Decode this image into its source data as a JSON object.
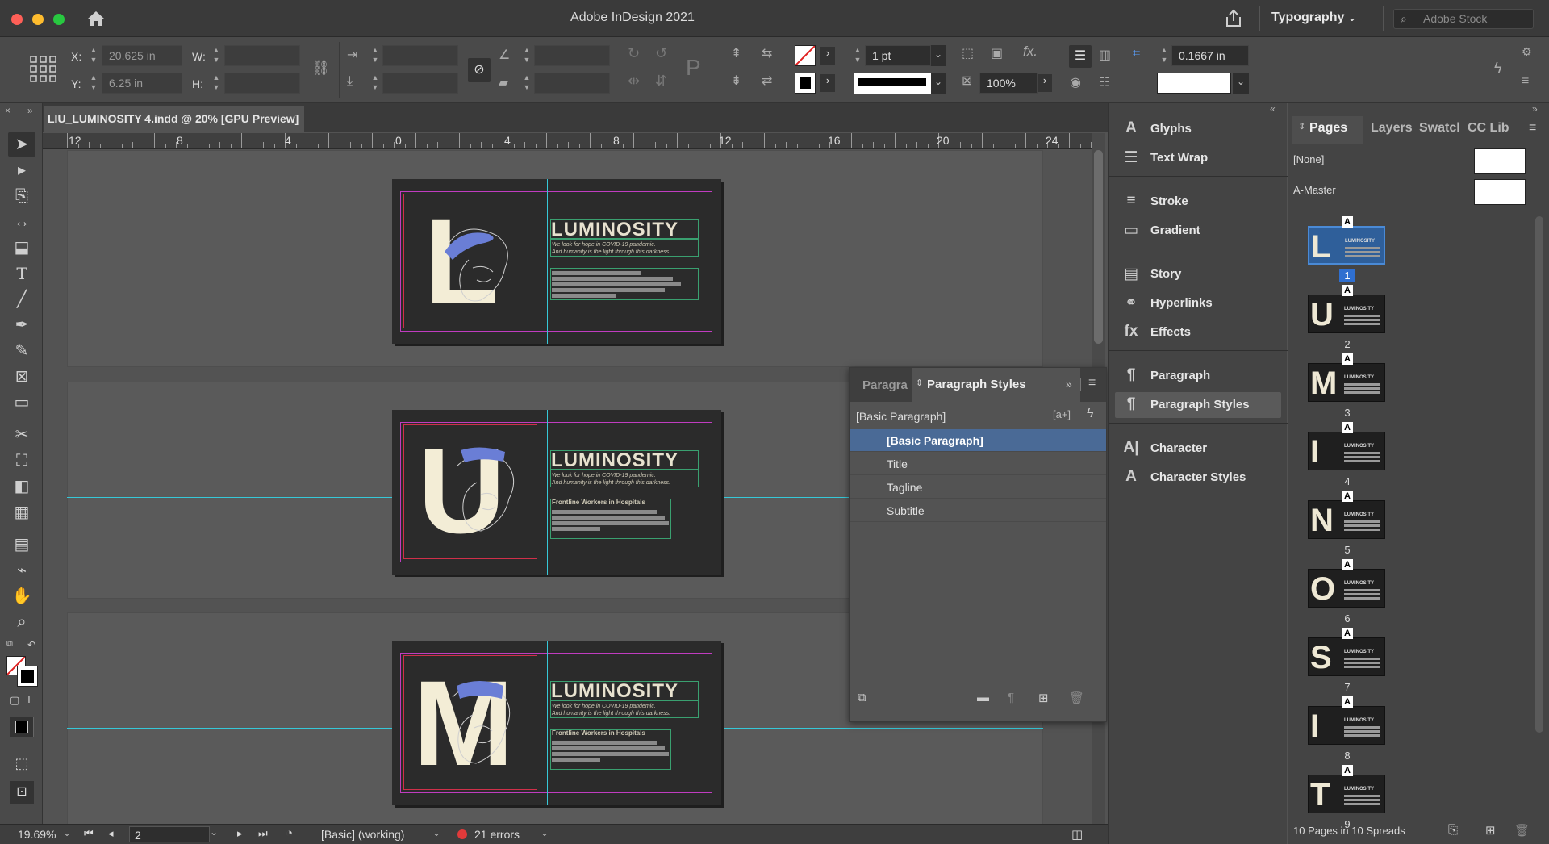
{
  "window": {
    "app_title": "Adobe InDesign 2021",
    "workspace": "Typography",
    "search_placeholder": "Adobe Stock"
  },
  "control_bar": {
    "x_label": "X:",
    "x_value": "20.625 in",
    "y_label": "Y:",
    "y_value": "6.25 in",
    "w_label": "W:",
    "h_label": "H:",
    "stroke_weight": "1 pt",
    "scale_value": "100%",
    "offset_value": "0.1667 in"
  },
  "document": {
    "tab_title": "LIU_LUMINOSITY 4.indd @ 20% [GPU Preview]",
    "ruler_labels": [
      "12",
      "8",
      "4",
      "0",
      "4",
      "8",
      "12",
      "16",
      "20",
      "24"
    ],
    "pages": [
      {
        "letter": "L",
        "title": "LUMINOSITY",
        "tagline_1": "We look for hope in COVID-19 pandemic.",
        "tagline_2": "And humanity is the light through this darkness.",
        "subtitle": ""
      },
      {
        "letter": "U",
        "title": "LUMINOSITY",
        "tagline_1": "We look for hope in COVID-19 pandemic.",
        "tagline_2": "And humanity is the light through this darkness.",
        "subtitle": "Frontline Workers in Hospitals"
      },
      {
        "letter": "M",
        "title": "LUMINOSITY",
        "tagline_1": "We look for hope in COVID-19 pandemic.",
        "tagline_2": "And humanity is the light through this darkness.",
        "subtitle": "Frontline Workers in Hospitals"
      }
    ]
  },
  "status_bar": {
    "zoom": "19.69%",
    "page": "2",
    "preflight_profile": "[Basic] (working)",
    "errors": "21 errors",
    "error_color": "#e03a3a"
  },
  "paragraph_styles_panel": {
    "tab_inactive": "Paragra",
    "tab_active": "Paragraph Styles",
    "current_style": "[Basic Paragraph]",
    "styles": [
      "[Basic Paragraph]",
      "Title",
      "Tagline",
      "Subtitle"
    ],
    "selected_index": 0
  },
  "dock": {
    "items": [
      {
        "label": "Glyphs",
        "icon": "glyphs-icon",
        "glyph": "A"
      },
      {
        "label": "Text Wrap",
        "icon": "text-wrap-icon",
        "glyph": "☰"
      },
      {
        "label": "Stroke",
        "icon": "stroke-icon",
        "glyph": "≡"
      },
      {
        "label": "Gradient",
        "icon": "gradient-icon",
        "glyph": "▭"
      },
      {
        "label": "Story",
        "icon": "story-icon",
        "glyph": "▤"
      },
      {
        "label": "Hyperlinks",
        "icon": "hyperlinks-icon",
        "glyph": "⚭"
      },
      {
        "label": "Effects",
        "icon": "effects-icon",
        "glyph": "fx"
      },
      {
        "label": "Paragraph",
        "icon": "paragraph-icon",
        "glyph": "¶"
      },
      {
        "label": "Paragraph Styles",
        "icon": "paragraph-styles-icon",
        "glyph": "¶"
      },
      {
        "label": "Character",
        "icon": "character-icon",
        "glyph": "A|"
      },
      {
        "label": "Character Styles",
        "icon": "character-styles-icon",
        "glyph": "A"
      }
    ],
    "selected": "Paragraph Styles"
  },
  "pages_panel": {
    "tabs": [
      "Pages",
      "Layers",
      "Swatcl",
      "CC Lib"
    ],
    "active_tab": "Pages",
    "none_label": "[None]",
    "master_label": "A-Master",
    "thumbs": [
      {
        "num": "1",
        "letter": "L",
        "master": "A"
      },
      {
        "num": "2",
        "letter": "U",
        "master": "A"
      },
      {
        "num": "3",
        "letter": "M",
        "master": "A"
      },
      {
        "num": "4",
        "letter": "I",
        "master": "A"
      },
      {
        "num": "5",
        "letter": "N",
        "master": "A"
      },
      {
        "num": "6",
        "letter": "O",
        "master": "A"
      },
      {
        "num": "7",
        "letter": "S",
        "master": "A"
      },
      {
        "num": "8",
        "letter": "I",
        "master": "A"
      },
      {
        "num": "9",
        "letter": "T",
        "master": "A"
      }
    ],
    "thumb_caption": "LUMINOSITY",
    "selected_page": "1",
    "footer": "10 Pages in 10 Spreads"
  },
  "colors": {
    "selection": "#4a6a96",
    "guide": "#36c8d8",
    "page_bg": "#2b2b2b",
    "cream": "#f3edd6",
    "hair_blue": "#6a7ed6"
  }
}
